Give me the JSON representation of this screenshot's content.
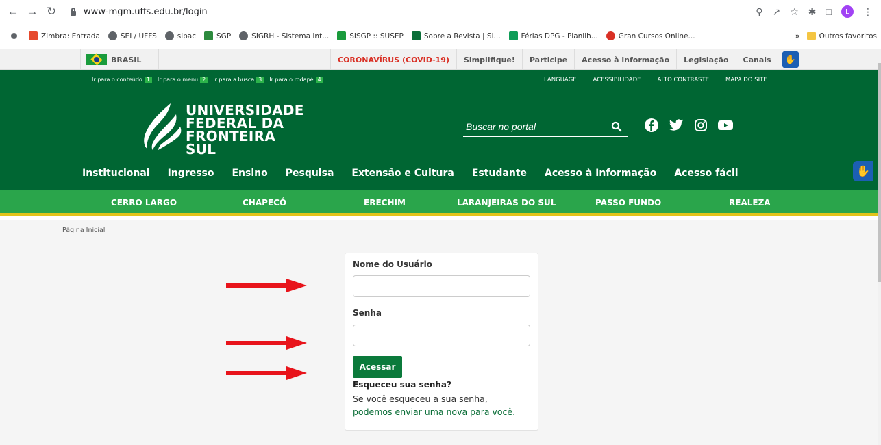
{
  "browser": {
    "url": "www-mgm.uffs.edu.br/login",
    "bookmarks": [
      {
        "label": "Zimbra: Entrada",
        "color": "#e6492d"
      },
      {
        "label": "SEI / UFFS",
        "color": "#5f6368"
      },
      {
        "label": "sipac",
        "color": "#5f6368"
      },
      {
        "label": "SGP",
        "color": "#2d8a3e"
      },
      {
        "label": "SIGRH - Sistema Int...",
        "color": "#5f6368"
      },
      {
        "label": "SISGP :: SUSEP",
        "color": "#1a9b3c"
      },
      {
        "label": "Sobre a Revista | Si...",
        "color": "#0b6e38"
      },
      {
        "label": "Férias DPG - Planilh...",
        "color": "#0f9d58"
      },
      {
        "label": "Gran Cursos Online...",
        "color": "#d93025"
      }
    ],
    "bookmarks_more": "»",
    "other_bookmarks": "Outros favoritos",
    "profile_initial": "L"
  },
  "govbar": {
    "brasil": "BRASIL",
    "links": [
      "CORONAVÍRUS (COVID-19)",
      "Simplifique!",
      "Participe",
      "Acesso à informação",
      "Legislação",
      "Canais"
    ]
  },
  "header": {
    "skip_links": [
      {
        "label": "Ir para o conteúdo",
        "key": "1"
      },
      {
        "label": "Ir para o menu",
        "key": "2"
      },
      {
        "label": "Ir para a busca",
        "key": "3"
      },
      {
        "label": "Ir para o rodapé",
        "key": "4"
      }
    ],
    "top_links": [
      "LANGUAGE",
      "ACESSIBILIDADE",
      "ALTO CONTRASTE",
      "MAPA DO SITE"
    ],
    "logo_line1": "UNIVERSIDADE",
    "logo_line2": "FEDERAL DA",
    "logo_line3": "FRONTEIRA SUL",
    "search_placeholder": "Buscar no portal",
    "menu": [
      "Institucional",
      "Ingresso",
      "Ensino",
      "Pesquisa",
      "Extensão e Cultura",
      "Estudante",
      "Acesso à Informação",
      "Acesso fácil"
    ]
  },
  "campus": [
    "CERRO LARGO",
    "CHAPECÓ",
    "ERECHIM",
    "LARANJEIRAS DO SUL",
    "PASSO FUNDO",
    "REALEZA"
  ],
  "content": {
    "breadcrumb": "Página Inicial",
    "username_label": "Nome do Usuário",
    "username_value": "",
    "password_label": "Senha",
    "password_value": "",
    "submit_label": "Acessar",
    "forgot_title": "Esqueceu sua senha?",
    "forgot_text": "Se você esqueceu a sua senha,",
    "forgot_link": "podemos enviar uma nova para você."
  },
  "colors": {
    "header_green": "#006633",
    "campus_green": "#2aa54b",
    "accent_yellow": "#e2c31a",
    "button_green": "#0b7a3b",
    "arrow_red": "#e8141b"
  }
}
